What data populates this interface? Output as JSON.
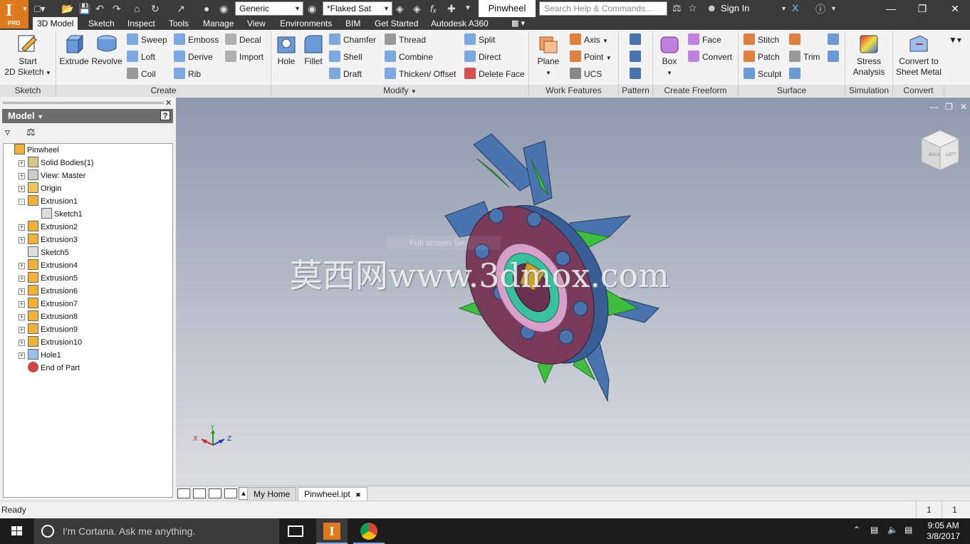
{
  "app": {
    "logo_letter": "I",
    "logo_badge": "PRO",
    "material_combo": "Generic",
    "appearance_combo": "*Flaked Sat",
    "title": "Pinwheel",
    "search_placeholder": "Search Help & Commands...",
    "sign_in": "Sign In"
  },
  "ribbon_tabs": [
    "3D Model",
    "Sketch",
    "Inspect",
    "Tools",
    "Manage",
    "View",
    "Environments",
    "BIM",
    "Get Started",
    "Autodesk A360"
  ],
  "ribbon": {
    "sketch": {
      "start_line1": "Start",
      "start_line2": "2D Sketch",
      "label": "Sketch"
    },
    "create": {
      "extrude": "Extrude",
      "revolve": "Revolve",
      "sweep": "Sweep",
      "loft": "Loft",
      "coil": "Coil",
      "emboss": "Emboss",
      "derive": "Derive",
      "rib": "Rib",
      "decal": "Decal",
      "import": "Import",
      "label": "Create"
    },
    "modify": {
      "hole": "Hole",
      "fillet": "Fillet",
      "chamfer": "Chamfer",
      "shell": "Shell",
      "draft": "Draft",
      "thread": "Thread",
      "combine": "Combine",
      "thicken": "Thicken/ Offset",
      "split": "Split",
      "direct": "Direct",
      "delete_face": "Delete Face",
      "label": "Modify"
    },
    "work_features": {
      "plane": "Plane",
      "axis": "Axis",
      "point": "Point",
      "ucs": "UCS",
      "label": "Work Features"
    },
    "pattern": {
      "label": "Pattern"
    },
    "freeform": {
      "box": "Box",
      "face": "Face",
      "convert": "Convert",
      "label": "Create Freeform"
    },
    "surface": {
      "stitch": "Stitch",
      "patch": "Patch",
      "sculpt": "Sculpt",
      "trim": "Trim",
      "label": "Surface"
    },
    "simulation": {
      "line1": "Stress",
      "line2": "Analysis",
      "label": "Simulation"
    },
    "convert": {
      "line1": "Convert to",
      "line2": "Sheet Metal",
      "label": "Convert"
    }
  },
  "browser": {
    "header": "Model",
    "tree": [
      {
        "label": "Pinwheel",
        "icon": "part-icon",
        "indent": 0,
        "expander": ""
      },
      {
        "label": "Solid Bodies(1)",
        "icon": "solid-bodies-icon",
        "indent": 1,
        "expander": "+"
      },
      {
        "label": "View: Master",
        "icon": "view-icon",
        "indent": 1,
        "expander": "+"
      },
      {
        "label": "Origin",
        "icon": "folder-icon",
        "indent": 1,
        "expander": "+"
      },
      {
        "label": "Extrusion1",
        "icon": "extrusion-icon",
        "indent": 1,
        "expander": "-"
      },
      {
        "label": "Sketch1",
        "icon": "sketch-icon",
        "indent": 2,
        "expander": ""
      },
      {
        "label": "Extrusion2",
        "icon": "extrusion-icon",
        "indent": 1,
        "expander": "+"
      },
      {
        "label": "Extrusion3",
        "icon": "extrusion-icon",
        "indent": 1,
        "expander": "+"
      },
      {
        "label": "Sketch5",
        "icon": "sketch-icon",
        "indent": 1,
        "expander": ""
      },
      {
        "label": "Extrusion4",
        "icon": "extrusion-icon",
        "indent": 1,
        "expander": "+"
      },
      {
        "label": "Extrusion5",
        "icon": "extrusion-icon",
        "indent": 1,
        "expander": "+"
      },
      {
        "label": "Extrusion6",
        "icon": "extrusion-icon",
        "indent": 1,
        "expander": "+"
      },
      {
        "label": "Extrusion7",
        "icon": "extrusion-icon",
        "indent": 1,
        "expander": "+"
      },
      {
        "label": "Extrusion8",
        "icon": "extrusion-icon",
        "indent": 1,
        "expander": "+"
      },
      {
        "label": "Extrusion9",
        "icon": "extrusion-icon",
        "indent": 1,
        "expander": "+"
      },
      {
        "label": "Extrusion10",
        "icon": "extrusion-icon",
        "indent": 1,
        "expander": "+"
      },
      {
        "label": "Hole1",
        "icon": "hole-icon",
        "indent": 1,
        "expander": "+"
      },
      {
        "label": "End of Part",
        "icon": "end-of-part-icon",
        "indent": 1,
        "expander": ""
      }
    ]
  },
  "viewport": {
    "watermark": "莫西网www.3dmox.com",
    "fullscreen_hint": "Full screen Se",
    "axis_x": "X",
    "axis_y": "Y",
    "axis_z": "Z",
    "viewcube_back": "BACK",
    "viewcube_left": "LEFT"
  },
  "doc_tabs": {
    "home": "My Home",
    "file": "Pinwheel.ipt"
  },
  "status": {
    "text": "Ready",
    "count1": "1",
    "count2": "1"
  },
  "taskbar": {
    "cortana": "I'm Cortana. Ask me anything.",
    "time": "9:05 AM",
    "date": "3/8/2017"
  },
  "colors": {
    "accent": "#e07a1f",
    "part_blue": "#4a74b0",
    "part_purple": "#7a3a5a",
    "green": "#3fbf3f"
  }
}
